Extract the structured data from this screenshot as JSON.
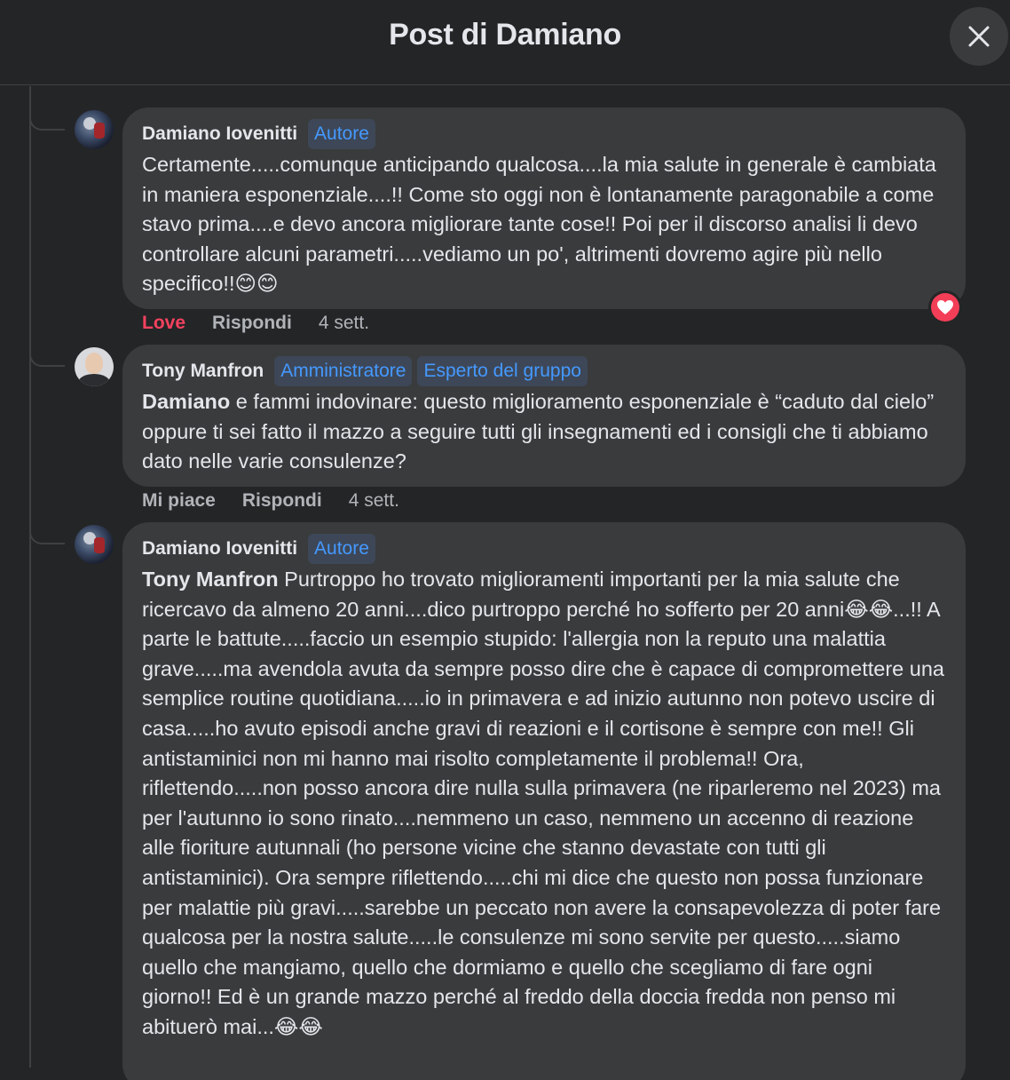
{
  "header": {
    "title": "Post di Damiano",
    "close_icon": "close-icon"
  },
  "comments": [
    {
      "author": "Damiano Iovenitti",
      "badges": [
        "Autore"
      ],
      "avatar": "avatar-damiano",
      "text": "Certamente.....comunque anticipando qualcosa....la mia salute in generale è cambiata in maniera esponenziale....!! Come sto oggi non è lontanamente paragonabile a come stavo prima....e devo ancora migliorare tante cose!! Poi per il discorso analisi li devo controllare alcuni parametri.....vediamo un po', altrimenti dovremo agire più nello specifico!!😊😊",
      "actions": {
        "like": "Love",
        "reply": "Rispondi",
        "time": "4 sett."
      },
      "reaction": "heart-icon"
    },
    {
      "author": "Tony Manfron",
      "badges": [
        "Amministratore",
        "Esperto del gruppo"
      ],
      "avatar": "avatar-tony",
      "mention": "Damiano",
      "text": " e fammi indovinare: questo miglioramento esponenziale è “caduto dal cielo” oppure ti sei fatto il mazzo a seguire tutti gli insegnamenti ed i consigli che ti abbiamo dato nelle varie consulenze?",
      "actions": {
        "like": "Mi piace",
        "reply": "Rispondi",
        "time": "4 sett."
      }
    },
    {
      "author": "Damiano Iovenitti",
      "badges": [
        "Autore"
      ],
      "avatar": "avatar-damiano",
      "mention": "Tony Manfron",
      "text": " Purtroppo ho trovato miglioramenti importanti per la mia salute che ricercavo da almeno 20 anni....dico purtroppo perché ho sofferto per 20 anni😂😂...!! A parte le battute.....faccio un esempio stupido: l'allergia non la reputo una malattia grave.....ma avendola avuta da sempre posso dire che è capace di compromettere una semplice routine quotidiana.....io in primavera e ad inizio autunno non potevo uscire di casa.....ho avuto episodi anche gravi di reazioni e il cortisone è sempre con me!! Gli antistaminici non mi hanno mai risolto completamente il problema!! Ora, riflettendo.....non posso ancora dire nulla sulla primavera (ne riparleremo nel 2023) ma per l'autunno io sono rinato....nemmeno un caso, nemmeno un accenno di reazione alle fioriture autunnali (ho persone vicine che stanno devastate con tutti gli antistaminici). Ora sempre riflettendo.....chi mi dice che questo non possa funzionare per malattie più gravi.....sarebbe un peccato non avere la consapevolezza di poter fare qualcosa per la nostra salute.....le consulenze mi sono servite per questo.....siamo quello che mangiamo, quello che dormiamo e quello che scegliamo di fare ogni giorno!! Ed è un grande mazzo perché al freddo della doccia fredda non penso mi abituerò mai...😂😂"
    }
  ]
}
